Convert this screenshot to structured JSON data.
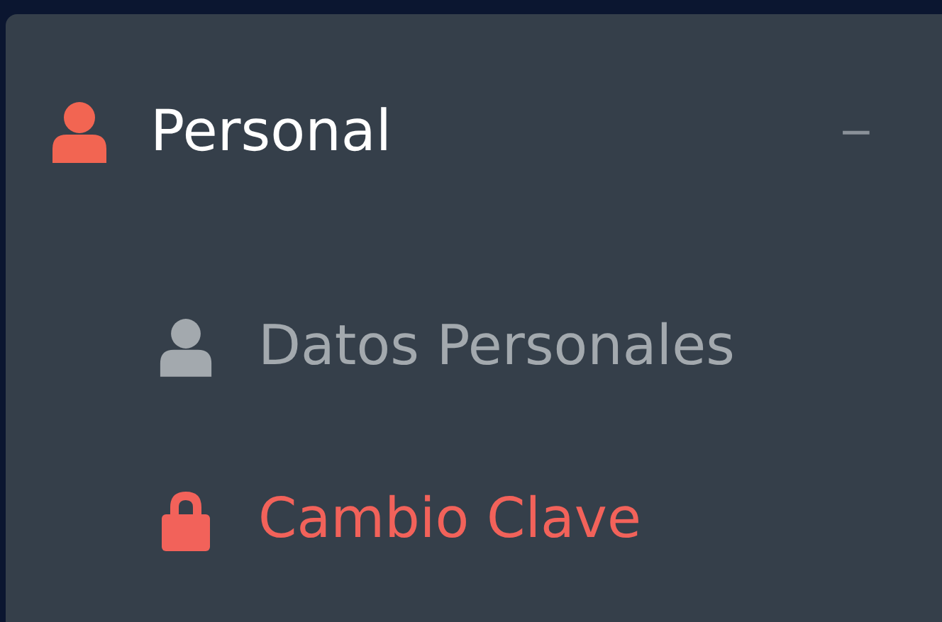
{
  "menu": {
    "title": "Personal",
    "expanded": true,
    "toggle": "−",
    "items": [
      {
        "label": "Datos Personales",
        "kind": "user",
        "selected": false
      },
      {
        "label": "Cambio Clave",
        "kind": "lock",
        "selected": true
      }
    ]
  }
}
